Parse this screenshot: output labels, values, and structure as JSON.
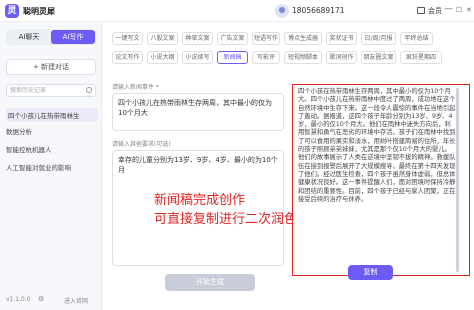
{
  "app": {
    "name": "聪明灵犀",
    "logo_glyph": "灵"
  },
  "header": {
    "phone": "18056689171",
    "vip_label": "会员",
    "min": "—",
    "max": "☐",
    "close": "✕"
  },
  "sidebar": {
    "mode_tabs": [
      "AI聊天",
      "AI写作"
    ],
    "new_chat": "+ 新建对话",
    "search_placeholder": "搜索历史记录",
    "history": [
      "四个小孩儿在热带雨林生",
      "数据分析",
      "智能控杭机器人",
      "人工智能对就业的影响"
    ],
    "version": "v1.1.0.0",
    "enter_web": "进入官网"
  },
  "tags_row1": [
    "一键写文",
    "八股文案",
    "种草文案",
    "广告文案",
    "短语写作",
    "博点生成器",
    "奖状证书",
    "日/周/月报",
    "年终总结"
  ],
  "tags_row2": [
    "论文写作",
    "小说大纲",
    "小说续写",
    "新闻稿",
    "写影评",
    "短视频脚本",
    "歌词创作",
    "朋友圈文案",
    "疯狂星期四"
  ],
  "form": {
    "label1": "请输入新闻事件 *",
    "value1": "四个小孩儿在热带雨林生存两周，其中最小的仅为10个月大",
    "label2": "请输入其他要求(可选)",
    "value2": "幸存的儿童分别为13岁、9岁、4岁、最小的为10个月",
    "generate": "开始生成"
  },
  "overlay": {
    "line1": "新闻稿完成创作",
    "line2": "可直接复制进行二次润色"
  },
  "output": {
    "text": "四个小孩在热带雨林生存两周，其中最小的仅为10个月大。四个小孩儿在热带雨林中度过了两周，成功地在这个自然环境中生存下来。这一段令人震惊的事件在当地引起了轰动。据报道，这四个孩子年龄分别为13岁、9岁、4岁，最小的仅10个月大。他们在雨林中迷失方向后，利用智慧和勇气在恶劣的环境中存活。孩子们在雨林中找到了可以食用的果实和淡水，用树叶搭建简易的住所，年长的孩子照顾弟弟妹妹，尤其是那个仅10个月大的婴儿。他们的故事展示了人类在逆境中坚韧不拔的精神。救援队伍在接到报警后展开了大规模搜寻，最终在第十四天发现了他们。经过医生检查，四个孩子虽然身体虚弱，但总体健康状况良好。这一事件提醒人们，面对困境时保持冷静和团结的重要性。目前，四个孩子已经与家人团聚，正在接受后续的治疗与休养。",
    "copy": "复制"
  }
}
